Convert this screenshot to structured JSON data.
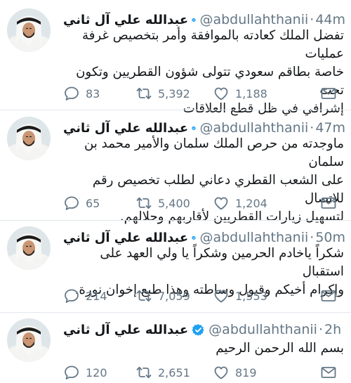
{
  "account": {
    "name": "عبدالله علي آل ثاني",
    "handle": "@abdullahthanii"
  },
  "tweets": [
    {
      "time": "44m",
      "lines": [
        "تفضل الملك كعادته بالموافقة وأمر بتخصيص غرفة عمليات",
        "خاصة بطاقم سعودي تتولى شؤون القطريين وتكون تحت",
        "إشرافي في ظل قطع العلاقات"
      ],
      "replies": "83",
      "retweets": "5,392",
      "likes": "1,188"
    },
    {
      "time": "47m",
      "lines": [
        "ماوجدته من حرص الملك سلمان والأمير محمد بن سلمان",
        "على الشعب القطري دعاني لطلب تخصيص رقم للاتصال",
        "لتسهيل زيارات القطريين لأقاربهم وحلالهم."
      ],
      "replies": "65",
      "retweets": "5,400",
      "likes": "1,204"
    },
    {
      "time": "50m",
      "lines": [
        "شكراً ياخادم الحرمين وشكراً يا ولي العهد على استقبال",
        "وإكرام أخيكم وقبول وساطته وهذا طبع إخوان نورة."
      ],
      "replies": "214",
      "retweets": "7,059",
      "likes": "1,553"
    },
    {
      "time": "2h",
      "lines": [
        "بسم الله الرحمن الرحيم"
      ],
      "replies": "120",
      "retweets": "2,651",
      "likes": "819"
    }
  ],
  "separator": "·",
  "colors": {
    "verified": "#1da1f2",
    "muted": "#657786",
    "divider": "#e1e8ed",
    "text": "#14171a"
  }
}
